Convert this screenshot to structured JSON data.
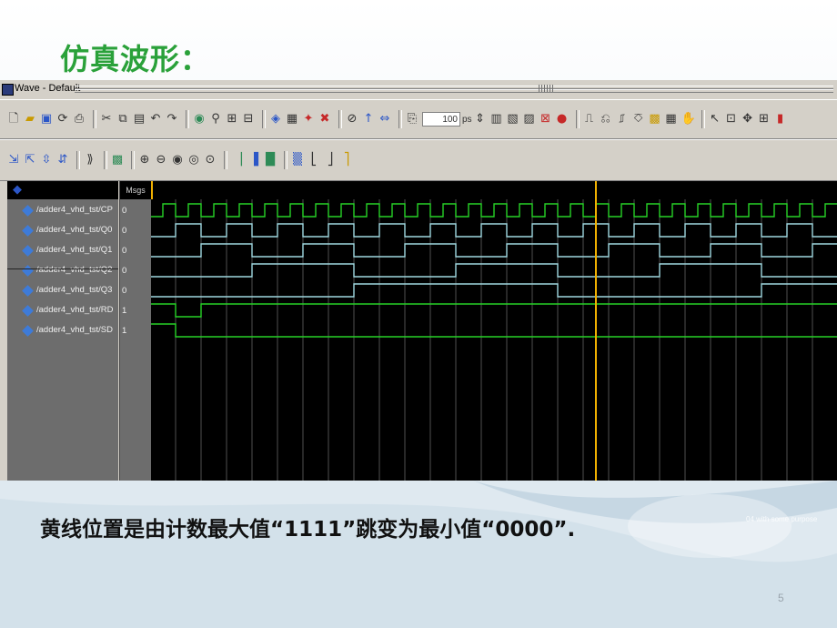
{
  "slide": {
    "title": "仿真波形：",
    "caption": "黄线位置是由计数最大值“1111”跳变为最小值“0000”.",
    "watermark": "04 with some purpose",
    "page_number": "5"
  },
  "window": {
    "title": "Wave - Default"
  },
  "toolbar": {
    "zoom_value": "100",
    "zoom_unit": "ps"
  },
  "wave": {
    "header_label": "Msgs",
    "signals": [
      {
        "name": "/adder4_vhd_tst/CP",
        "value": "0"
      },
      {
        "name": "/adder4_vhd_tst/Q0",
        "value": "0"
      },
      {
        "name": "/adder4_vhd_tst/Q1",
        "value": "0"
      },
      {
        "name": "/adder4_vhd_tst/Q2",
        "value": "0"
      },
      {
        "name": "/adder4_vhd_tst/Q3",
        "value": "0"
      },
      {
        "name": "/adder4_vhd_tst/RD",
        "value": "1"
      },
      {
        "name": "/adder4_vhd_tst/SD",
        "value": "1"
      }
    ]
  },
  "colors": {
    "wave_green": "#27d227",
    "wave_cyan": "#9fd8e0",
    "cursor_yellow": "#f0b000",
    "title_green": "#2aa13a"
  }
}
